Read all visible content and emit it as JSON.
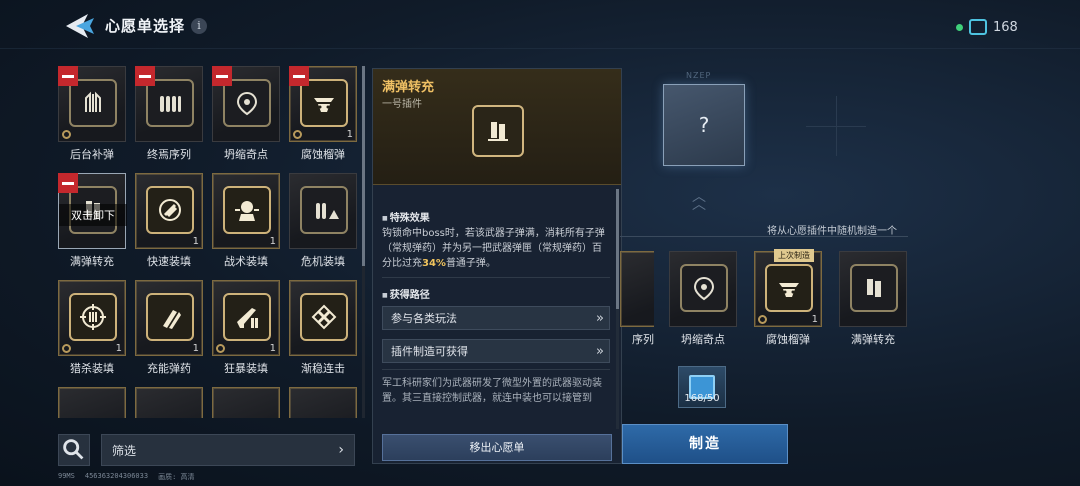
{
  "header": {
    "title": "心愿单选择",
    "info_glyph": "i",
    "currency_value": "168"
  },
  "wishlist": {
    "items": [
      {
        "name": "后台补弹",
        "count": "",
        "removable": true,
        "icon": "reload-icon"
      },
      {
        "name": "终焉序列",
        "count": "",
        "removable": true,
        "icon": "ammo-row-icon"
      },
      {
        "name": "坍缩奇点",
        "count": "",
        "removable": true,
        "icon": "singularity-icon"
      },
      {
        "name": "腐蚀榴弹",
        "count": "1",
        "removable": true,
        "icon": "corrosion-grenade-icon"
      },
      {
        "name": "满弹转充",
        "count": "",
        "removable": true,
        "icon": "mag-transfer-icon",
        "overlay": "双击卸下"
      },
      {
        "name": "快速装填",
        "count": "1",
        "removable": false,
        "icon": "fast-reload-icon"
      },
      {
        "name": "战术装填",
        "count": "1",
        "removable": false,
        "icon": "tactical-reload-icon"
      },
      {
        "name": "危机装填",
        "count": "",
        "removable": false,
        "icon": "crisis-reload-icon"
      },
      {
        "name": "猎杀装填",
        "count": "1",
        "removable": false,
        "icon": "hunt-reload-icon"
      },
      {
        "name": "充能弹药",
        "count": "1",
        "removable": false,
        "icon": "charged-ammo-icon"
      },
      {
        "name": "狂暴装填",
        "count": "1",
        "removable": false,
        "icon": "berserk-reload-icon"
      },
      {
        "name": "渐稳连击",
        "count": "",
        "removable": false,
        "icon": "steady-combo-icon"
      }
    ]
  },
  "filter": {
    "label": "筛选",
    "chevron": "›"
  },
  "statusbar": {
    "ping": "99MS",
    "uid": "456363204306033",
    "quality": "画质: 高清"
  },
  "detail": {
    "title": "满弹转充",
    "subtitle": "一号插件",
    "effect_title": "特殊效果",
    "effect_text_a": "钩锁命中boss时，若该武器子弹满，消耗所有子弹（常规弹药）并为另一把武器弹匣（常规弹药）百分比过充",
    "effect_highlight": "34%",
    "effect_text_b": "普通子弹。",
    "route_title": "获得路径",
    "routes": [
      {
        "label": "参与各类玩法"
      },
      {
        "label": "插件制造可获得"
      }
    ],
    "route_arrow": "»",
    "flavor": "军工科研家们为武器研发了微型外置的武器驱动装置。其三直接控制武器，就连中装也可以接管到",
    "remove_label": "移出心愿单"
  },
  "craft": {
    "slot_label": "NZEP",
    "random_glyph": "?",
    "hint": "将从心愿插件中随机制造一个",
    "last_made_tag": "上次制造",
    "pool": [
      {
        "name": "序列",
        "count": ""
      },
      {
        "name": "坍缩奇点",
        "count": ""
      },
      {
        "name": "腐蚀榴弹",
        "count": "1"
      },
      {
        "name": "满弹转充",
        "count": ""
      }
    ],
    "material_count": "168/50",
    "craft_label": "制造"
  },
  "colors": {
    "accent_gold": "#efc064",
    "remove_red": "#c4282d",
    "craft_blue": "#2e6aa8",
    "currency_green": "#3fd07a"
  }
}
